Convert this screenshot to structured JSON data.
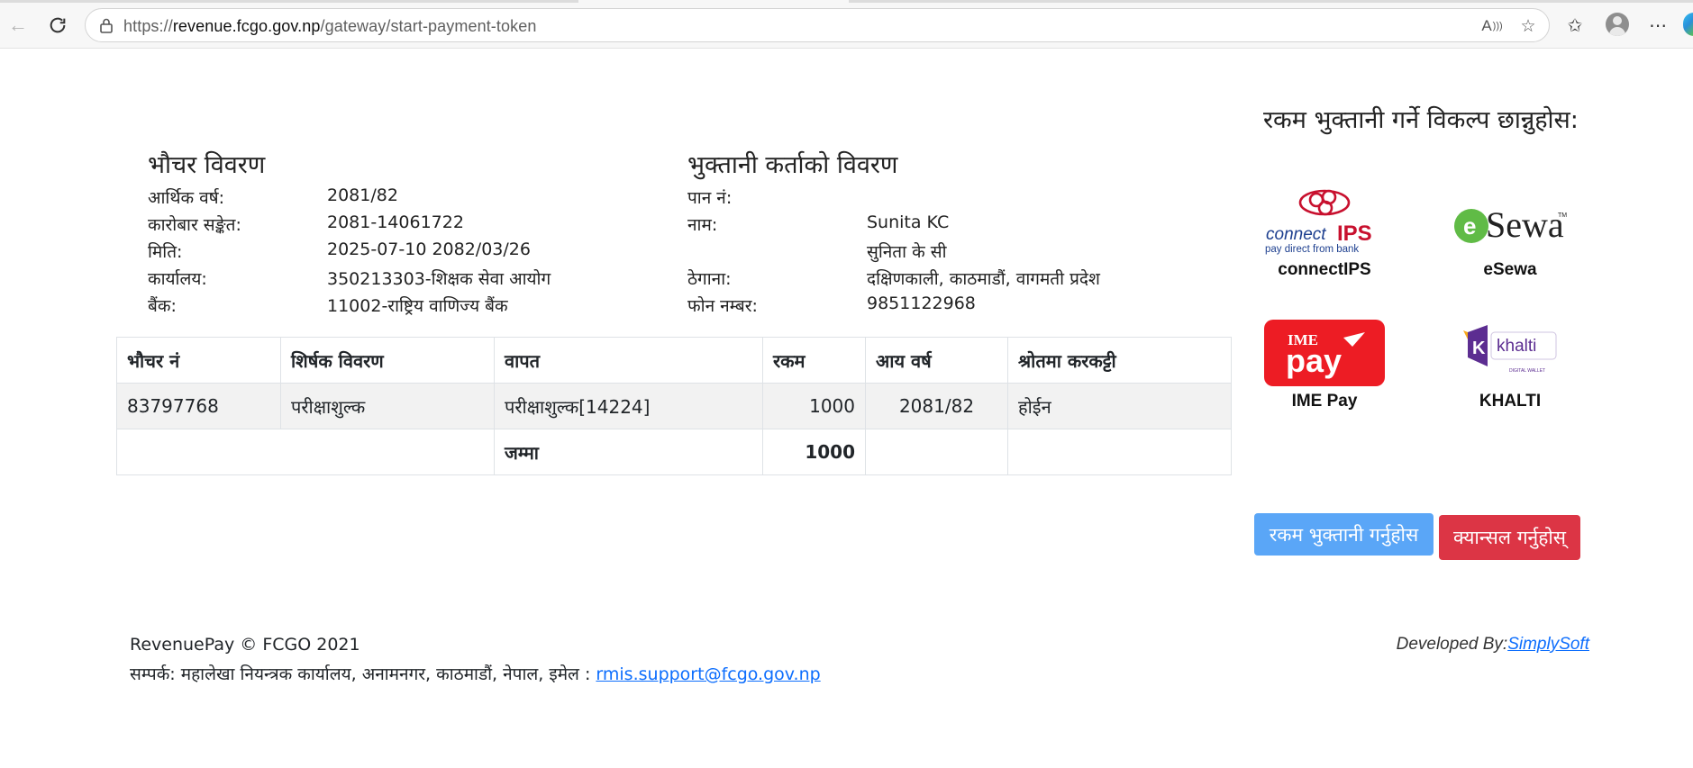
{
  "browser": {
    "url_prefix": "https://",
    "url_domain": "revenue.fcgo.gov.np",
    "url_path": "/gateway/start-payment-token",
    "icons": [
      "back-arrow-icon",
      "refresh-icon",
      "lock-icon",
      "read-aloud-icon",
      "favorite-star-icon",
      "favorites-icon",
      "profile-avatar-icon",
      "more-icon"
    ]
  },
  "voucher": {
    "heading": "भौचर विवरण",
    "fields": [
      {
        "label": "आर्थिक वर्ष:",
        "value": "2081/82"
      },
      {
        "label": "कारोबार सङ्केत:",
        "value": "2081-14061722"
      },
      {
        "label": "मिति:",
        "value": "2025-07-10 2082/03/26"
      },
      {
        "label": "कार्यालय:",
        "value": "350213303-शिक्षक सेवा आयोग"
      },
      {
        "label": "बैंक:",
        "value": "11002-राष्ट्रिय वाणिज्य बैंक"
      }
    ]
  },
  "payer": {
    "heading": "भुक्तानी कर्ताको विवरण",
    "pan_label": "पान नं:",
    "pan_value": "",
    "name_label": "नाम:",
    "name_value_en": "Sunita KC",
    "name_value_ne": "सुनिता के सी",
    "address_label": "ठेगाना:",
    "address_value": "दक्षिणकाली, काठमाडौं, वागमती प्रदेश",
    "phone_label": "फोन नम्बर:",
    "phone_value": "9851122968"
  },
  "table": {
    "headers": [
      "भौचर नं",
      "शिर्षक विवरण",
      "वापत",
      "रकम",
      "आय वर्ष",
      "श्रोतमा करकट्टी"
    ],
    "rows": [
      [
        "83797768",
        "परीक्षाशुल्क",
        "परीक्षाशुल्क[14224]",
        "1000",
        "2081/82",
        "होईन"
      ]
    ],
    "total_label": "जम्मा",
    "total_value": "1000"
  },
  "payment_options": {
    "title": "रकम भुक्तानी गर्ने विकल्प छान्नुहोस:",
    "options": [
      {
        "name": "connectIPS",
        "logo_text": "connect IPS",
        "logo_sub": "pay direct from bank",
        "color": "#c8102e"
      },
      {
        "name": "eSewa",
        "logo_text": "Sewa",
        "color": "#60bb46"
      },
      {
        "name": "IME Pay",
        "logo_text": "IME pay",
        "color": "#ed1c24"
      },
      {
        "name": "KHALTI",
        "logo_text": "khalti",
        "logo_sub": "DIGITAL WALLET",
        "color": "#5c2d91"
      }
    ]
  },
  "actions": {
    "pay_label": "रकम भुक्तानी गर्नुहोस",
    "cancel_label": "क्यान्सल गर्नुहोस्",
    "pay_color": "#5aa6f7",
    "cancel_color": "#dc3545"
  },
  "footer": {
    "copyright": "RevenuePay © FCGO 2021",
    "contact": "सम्पर्क: महालेखा नियन्त्रक कार्यालय, अनामनगर, काठमाडौं, नेपाल, इमेल : ",
    "email": "rmis.support@fcgo.gov.np",
    "developed_by": "Developed By:",
    "developer": "SimplySoft"
  }
}
